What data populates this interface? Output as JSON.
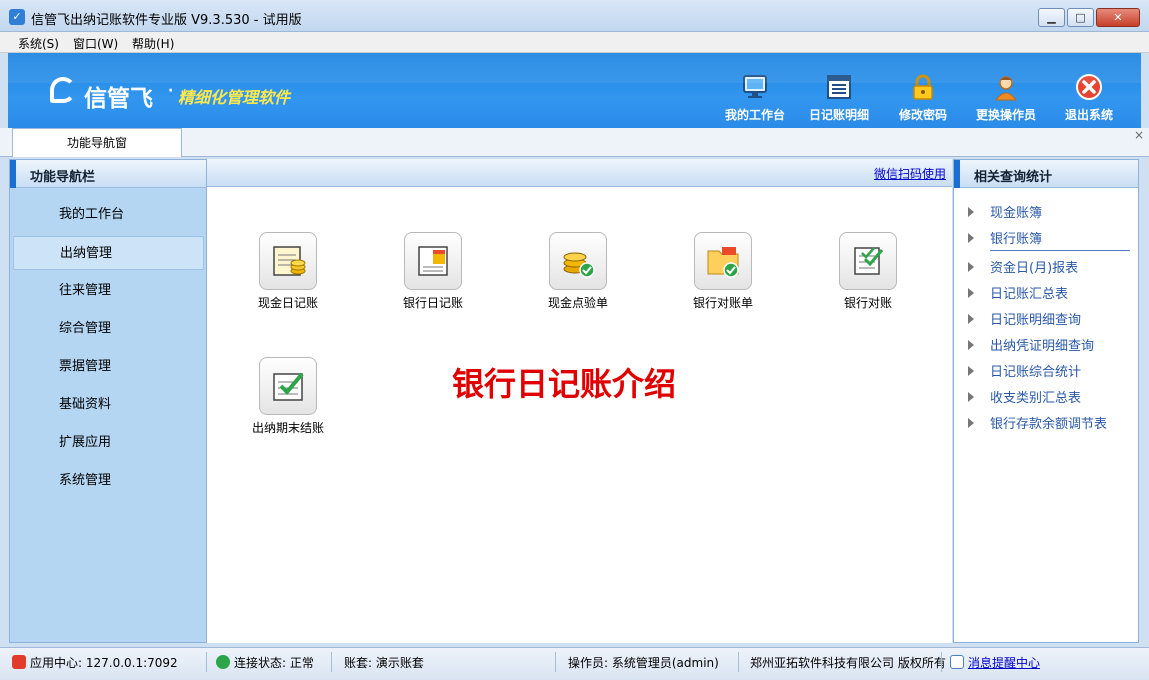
{
  "window": {
    "title": "信管飞出纳记账软件专业版 V9.3.530 - 试用版",
    "min": "▁",
    "max": "□",
    "close": "✕"
  },
  "menu": [
    "系统(S)",
    "窗口(W)",
    "帮助(H)"
  ],
  "banner": {
    "logo": "信管飞",
    "dot": "·",
    "slogan": "精细化管理软件",
    "toolbar": [
      "我的工作台",
      "日记账明细",
      "修改密码",
      "更换操作员",
      "退出系统"
    ]
  },
  "tabs": {
    "active": "功能导航窗",
    "close": "×"
  },
  "leftnav": {
    "title": "功能导航栏",
    "items": [
      "我的工作台",
      "出纳管理",
      "往来管理",
      "综合管理",
      "票据管理",
      "基础资料",
      "扩展应用",
      "系统管理"
    ]
  },
  "center": {
    "wechat": "微信扫码使用",
    "functions": [
      "现金日记账",
      "银行日记账",
      "现金点验单",
      "银行对账单",
      "银行对账",
      "出纳期末结账"
    ],
    "intro": "银行日记账介绍"
  },
  "rightpanel": {
    "title": "相关查询统计",
    "items": [
      "现金账簿",
      "银行账簿",
      "资金日(月)报表",
      "日记账汇总表",
      "日记账明细查询",
      "出纳凭证明细查询",
      "日记账综合统计",
      "收支类别汇总表",
      "银行存款余额调节表"
    ]
  },
  "status": {
    "app_center": "应用中心: 127.0.0.1:7092",
    "connection": "连接状态: 正常",
    "account_set": "账套: 演示账套",
    "operator": "操作员: 系统管理员(admin)",
    "copyright": "郑州亚拓软件科技有限公司 版权所有",
    "message_center": "消息提醒中心"
  },
  "colors": {
    "brand": "#2a8be8",
    "nav_bg": "#b4d6f3",
    "intro": "#e00000",
    "slogan": "#ffe94a"
  }
}
